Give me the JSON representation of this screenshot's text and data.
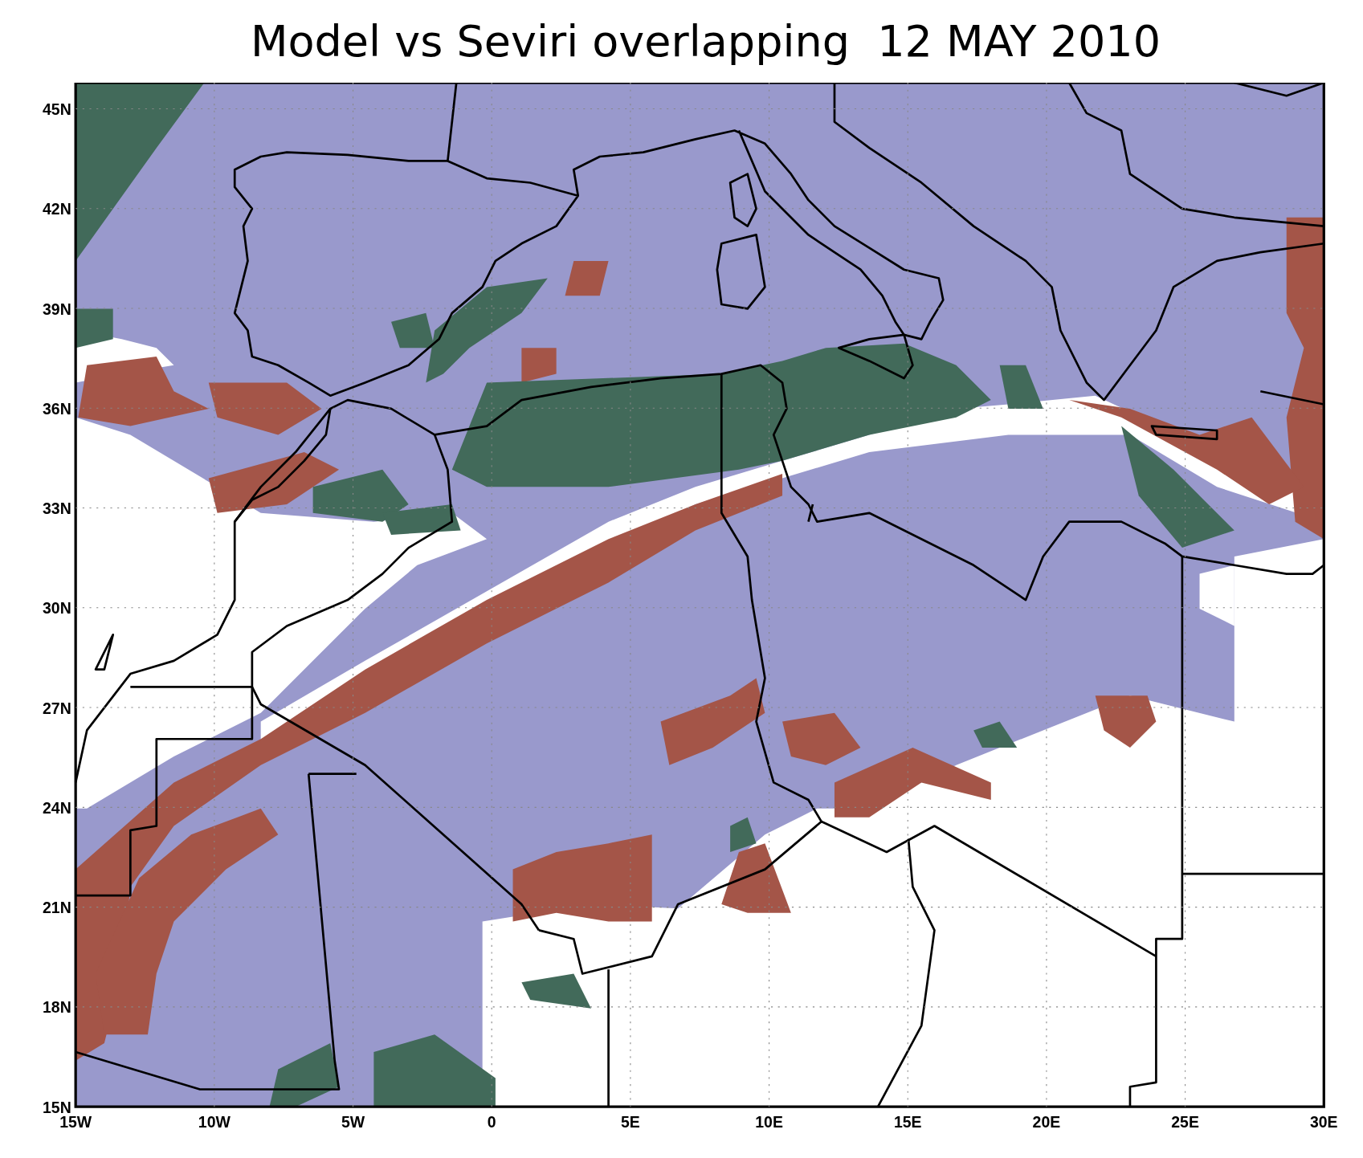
{
  "title": "Model vs Seviri overlapping  12 MAY 2010",
  "map": {
    "y_ticks": [
      "45N",
      "42N",
      "39N",
      "36N",
      "33N",
      "30N",
      "27N",
      "24N",
      "21N",
      "18N",
      "15N"
    ],
    "x_ticks": [
      "15W",
      "10W",
      "5W",
      "0",
      "5E",
      "10E",
      "15E",
      "20E",
      "25E",
      "30E"
    ]
  }
}
